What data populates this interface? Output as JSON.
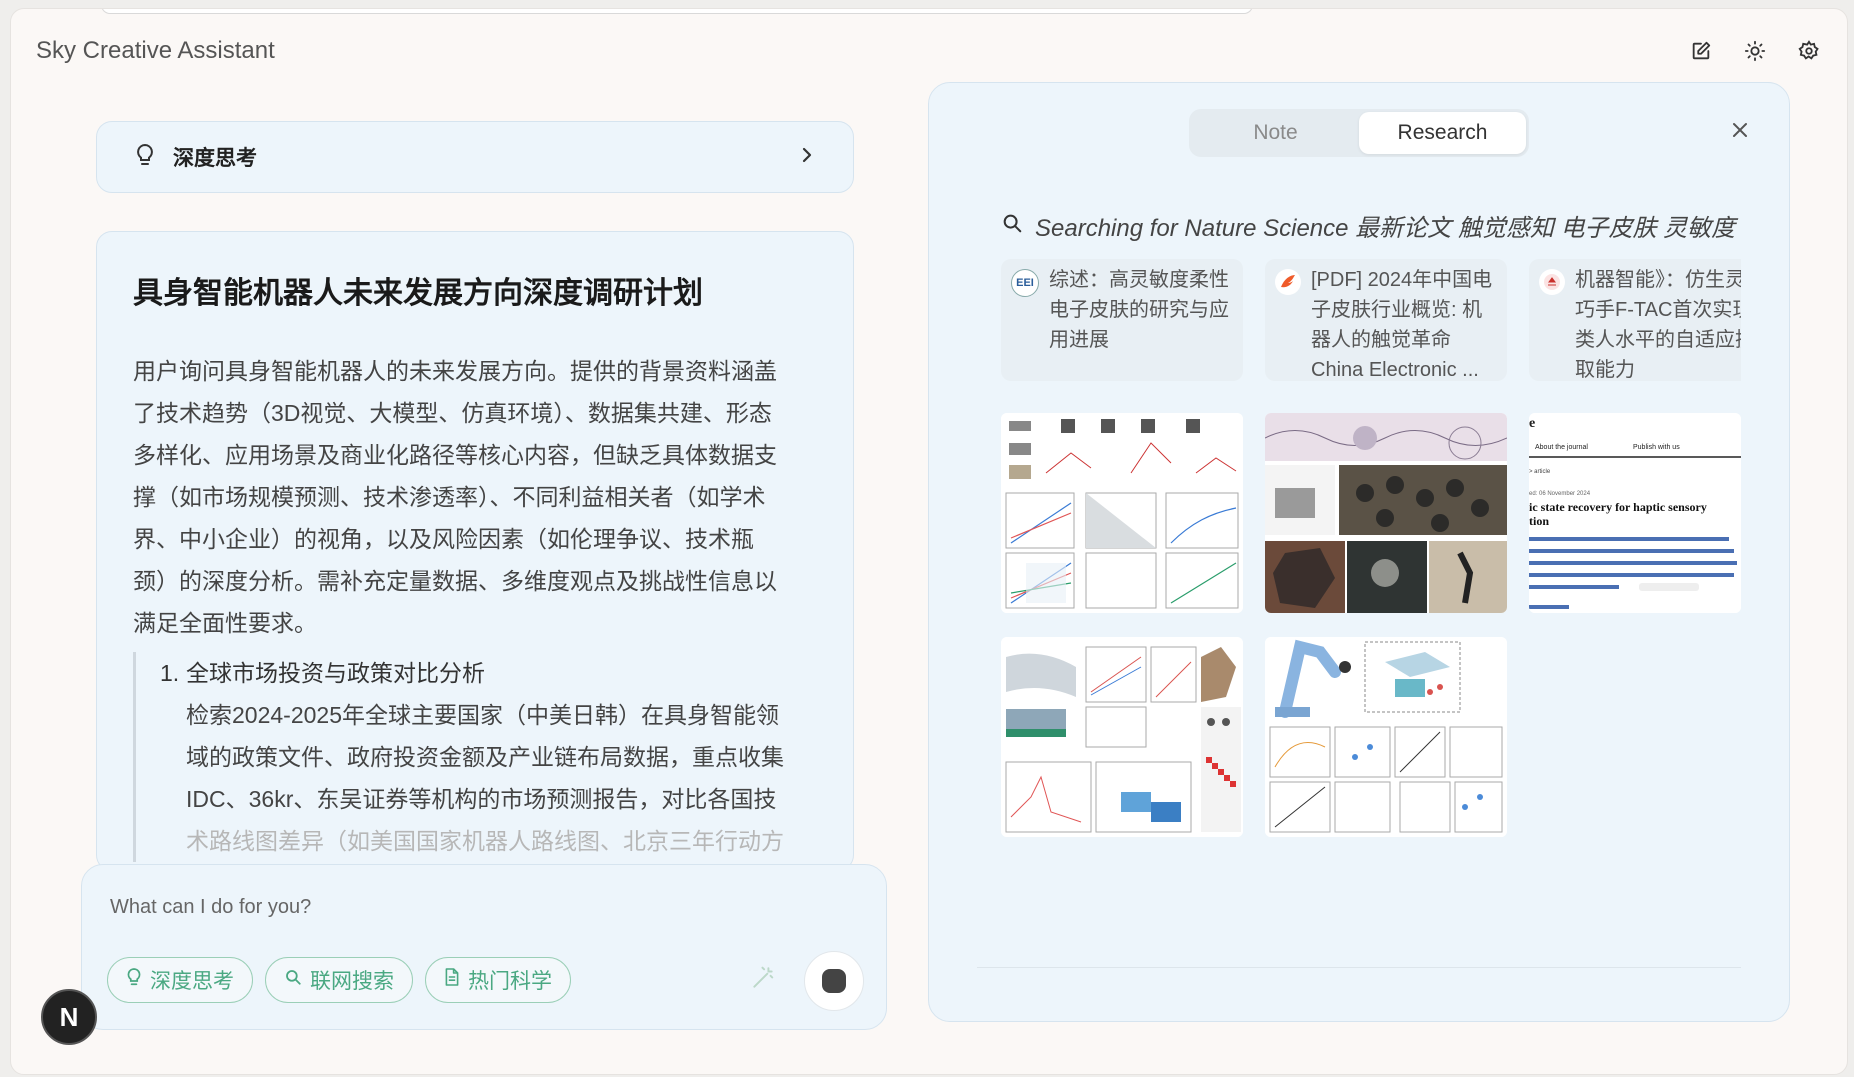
{
  "app": {
    "title": "Sky Creative Assistant"
  },
  "header_icons": [
    "edit-icon",
    "sun-icon",
    "settings-icon"
  ],
  "deep_thinking": {
    "label": "深度思考"
  },
  "plan": {
    "title": "具身智能机器人未来发展方向深度调研计划",
    "body_lines": [
      "用户询问具身智能机器人的未来发展方向。提供的背景资料涵盖",
      "了技术趋势（3D视觉、大模型、仿真环境）、数据集共建、形态",
      "多样化、应用场景及商业化路径等核心内容，但缺乏具体数据支",
      "撑（如市场规模预测、技术渗透率）、不同利益相关者（如学术",
      "界、中小企业）的视角，以及风险因素（如伦理争议、技术瓶",
      "颈）的深度分析。需补充定量数据、多维度观点及挑战性信息以",
      "满足全面性要求。"
    ],
    "steps": [
      {
        "number": "1.",
        "title": "全球市场投资与政策对比分析",
        "detail_lines": [
          "检索2024-2025年全球主要国家（中美日韩）在具身智能领",
          "域的政策文件、政府投资金额及产业链布局数据，重点收集",
          "IDC、36kr、东吴证券等机构的市场预测报告，对比各国技",
          "术路线图差异（如美国国家机器人路线图、北京三年行动方"
        ]
      }
    ]
  },
  "composer": {
    "placeholder": "What can I do for you?",
    "chips": [
      {
        "label": "深度思考",
        "icon": "lightbulb-icon"
      },
      {
        "label": "联网搜索",
        "icon": "search-icon"
      },
      {
        "label": "热门科学",
        "icon": "document-icon"
      }
    ]
  },
  "user_badge": {
    "initial": "N"
  },
  "research_panel": {
    "tabs": [
      {
        "label": "Note",
        "active": false
      },
      {
        "label": "Research",
        "active": true
      }
    ],
    "search_text": "Searching for Nature Science 最新论文 触觉感知 电子皮肤 灵敏度",
    "results": [
      {
        "title": "综述：高灵敏度柔性电子皮肤的研究与应用进展",
        "icon": "journal-favicon"
      },
      {
        "title": "[PDF] 2024年中国电子皮肤行业概览: 机器人的触觉革命 China Electronic ...",
        "icon": "report-favicon"
      },
      {
        "title": "机器智能》：仿生灵巧手F-TAC首次实现类人水平的自适应抓取能力",
        "icon": "news-favicon"
      }
    ],
    "images": [
      {
        "alt": "sensor-figure-charts"
      },
      {
        "alt": "robot-skin-photos"
      },
      {
        "alt": "journal-article-page",
        "heading": "ic state recovery for haptic sensory tion",
        "nav1": "About the journal",
        "nav2": "Publish with us",
        "date": "ed: 06 November 2024"
      },
      {
        "alt": "material-stability-figure"
      },
      {
        "alt": "robot-arm-figure"
      }
    ]
  },
  "colors": {
    "accent_green": "#4aa882",
    "card_bg": "#edf5fb",
    "page_bg": "#fbf8f6"
  }
}
